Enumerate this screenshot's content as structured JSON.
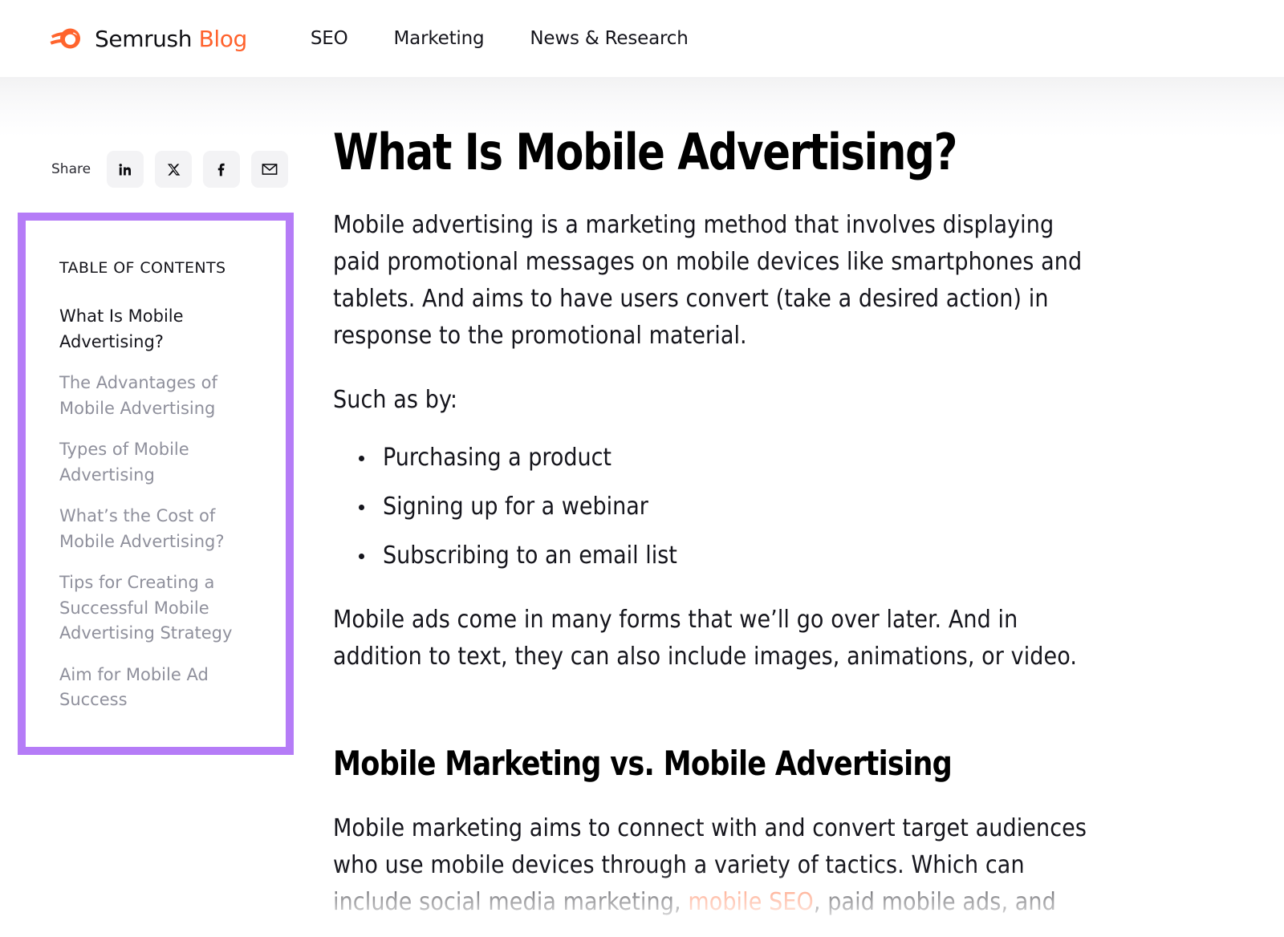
{
  "header": {
    "logo": {
      "icon": "semrush-comet-icon",
      "name": "Semrush",
      "suffix": "Blog",
      "accent_color": "#ff622d"
    },
    "nav": [
      {
        "label": "SEO",
        "name": "seo"
      },
      {
        "label": "Marketing",
        "name": "marketing"
      },
      {
        "label": "News & Research",
        "name": "news-research"
      }
    ]
  },
  "sidebar": {
    "share": {
      "label": "Share",
      "buttons": [
        {
          "icon": "linkedin-icon",
          "name": "linkedin"
        },
        {
          "icon": "x-twitter-icon",
          "name": "x-twitter"
        },
        {
          "icon": "facebook-icon",
          "name": "facebook"
        },
        {
          "icon": "email-icon",
          "name": "email"
        }
      ]
    },
    "toc": {
      "title": "TABLE OF CONTENTS",
      "border_color": "#b57cf7",
      "items": [
        {
          "label": "What Is Mobile Advertising?",
          "active": true
        },
        {
          "label": "The Advantages of Mobile Advertising",
          "active": false
        },
        {
          "label": "Types of Mobile Advertising",
          "active": false
        },
        {
          "label": "What’s the Cost of Mobile Advertising?",
          "active": false
        },
        {
          "label": "Tips for Creating a Successful Mobile Advertising Strategy",
          "active": false
        },
        {
          "label": "Aim for Mobile Ad Success",
          "active": false
        }
      ]
    }
  },
  "article": {
    "h1": "What Is Mobile Advertising?",
    "p1": "Mobile advertising is a marketing method that involves displaying paid promotional messages on mobile devices like smartphones and tablets. And aims to have users convert (take a desired action) in response to the promotional material.",
    "p2": "Such as by:",
    "bullets": [
      "Purchasing a product",
      "Signing up for a webinar",
      "Subscribing to an email list"
    ],
    "p3": "Mobile ads come in many forms that we’ll go over later. And in addition to text, they can also include images, animations, or video.",
    "h2": "Mobile Marketing vs. Mobile Advertising",
    "p4_part1": "Mobile marketing aims to connect with and convert target audiences who use mobile devices through a variety of tactics. Which can include social media marketing, ",
    "p4_link": "mobile SEO",
    "p4_part2": ", paid mobile ads, and",
    "link_color": "#ff7a4d"
  }
}
